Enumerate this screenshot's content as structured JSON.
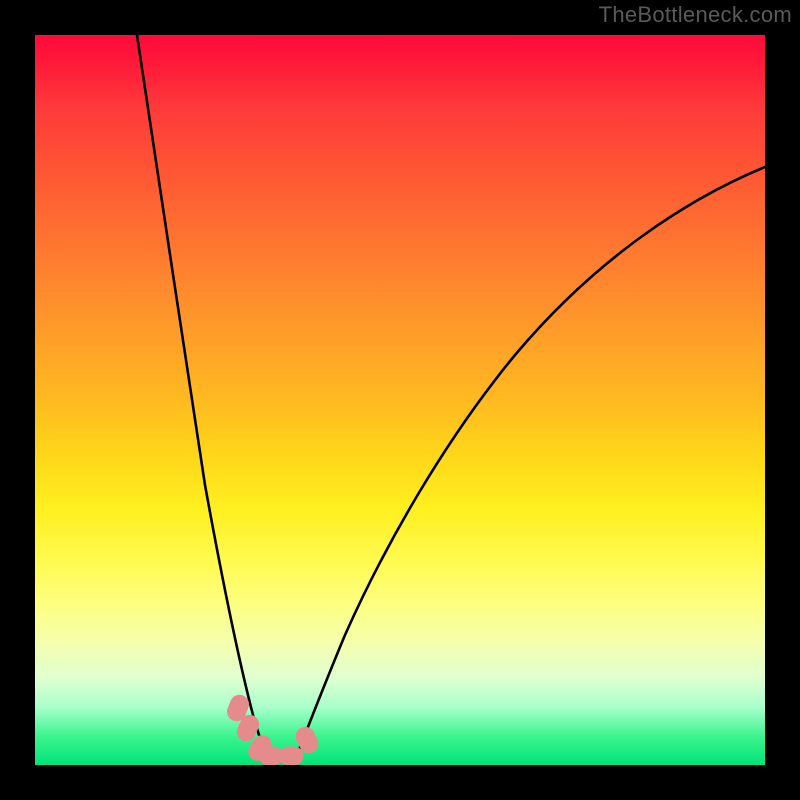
{
  "watermark": "TheBottleneck.com",
  "chart_data": {
    "type": "line",
    "title": "",
    "xlabel": "",
    "ylabel": "",
    "xlim": [
      0,
      100
    ],
    "ylim": [
      0,
      100
    ],
    "series": [
      {
        "name": "left-curve",
        "x": [
          14,
          15,
          16,
          17,
          18,
          19,
          20,
          21,
          22,
          23,
          24,
          25,
          26,
          27,
          28,
          29,
          30,
          31,
          32
        ],
        "y": [
          100,
          88,
          76,
          66,
          57,
          49,
          42,
          36,
          30,
          25,
          21,
          17,
          14,
          11,
          8,
          6,
          4,
          2,
          0
        ]
      },
      {
        "name": "right-curve",
        "x": [
          35,
          36,
          38,
          40,
          43,
          46,
          50,
          55,
          60,
          66,
          72,
          79,
          86,
          93,
          100
        ],
        "y": [
          0,
          3,
          7,
          12,
          19,
          26,
          34,
          42,
          50,
          57,
          63,
          69,
          74,
          78,
          82
        ]
      }
    ],
    "markers": [
      {
        "x": 27.5,
        "y": 8
      },
      {
        "x": 28.5,
        "y": 5.5
      },
      {
        "x": 30,
        "y": 2.5
      },
      {
        "x": 31,
        "y": 1
      },
      {
        "x": 33,
        "y": 1
      },
      {
        "x": 35,
        "y": 1
      },
      {
        "x": 37,
        "y": 4.5
      }
    ],
    "curve_color": "#000000",
    "marker_color": "#e58b8b",
    "background_gradient_top": "#ff0a3a",
    "background_gradient_bottom": "#00e478"
  }
}
